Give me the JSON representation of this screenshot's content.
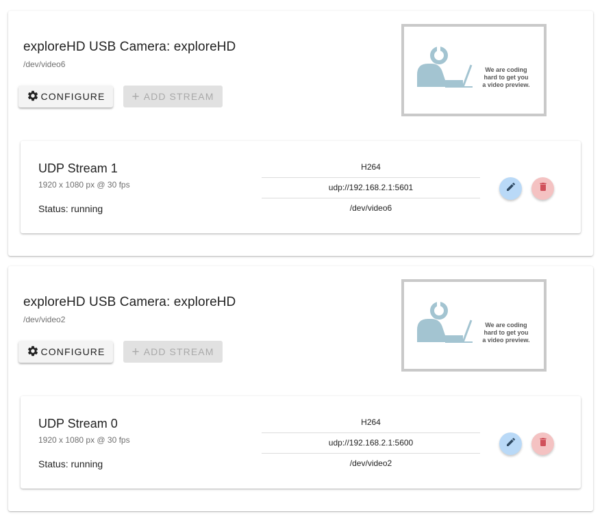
{
  "devices": [
    {
      "title": "exploreHD USB Camera: exploreHD",
      "path": "/dev/video6",
      "configure_label": "CONFIGURE",
      "add_stream_label": "ADD STREAM",
      "preview_caption": [
        "We are coding",
        "hard to get you",
        "a video preview."
      ],
      "stream": {
        "name": "UDP Stream 1",
        "resolution": "1920 x 1080 px @ 30 fps",
        "status": "Status: running",
        "encode": "H264",
        "endpoint": "udp://192.168.2.1:5601",
        "source": "/dev/video6"
      }
    },
    {
      "title": "exploreHD USB Camera: exploreHD",
      "path": "/dev/video2",
      "configure_label": "CONFIGURE",
      "add_stream_label": "ADD STREAM",
      "preview_caption": [
        "We are coding",
        "hard to get you",
        "a video preview."
      ],
      "stream": {
        "name": "UDP Stream 0",
        "resolution": "1920 x 1080 px @ 30 fps",
        "status": "Status: running",
        "encode": "H264",
        "endpoint": "udp://192.168.2.1:5600",
        "source": "/dev/video2"
      }
    }
  ],
  "icons": {
    "configure": "gear-icon",
    "add_stream": "plus-icon",
    "edit": "pencil-icon",
    "delete": "trash-icon",
    "preview": "person-at-laptop-illustration"
  },
  "colors": {
    "edit_button": "#b9d9f7",
    "delete_button": "#f4c2c2",
    "edit_icon": "#2f4a63",
    "delete_icon": "#d0505a",
    "illustration": "#a3c4d1"
  }
}
